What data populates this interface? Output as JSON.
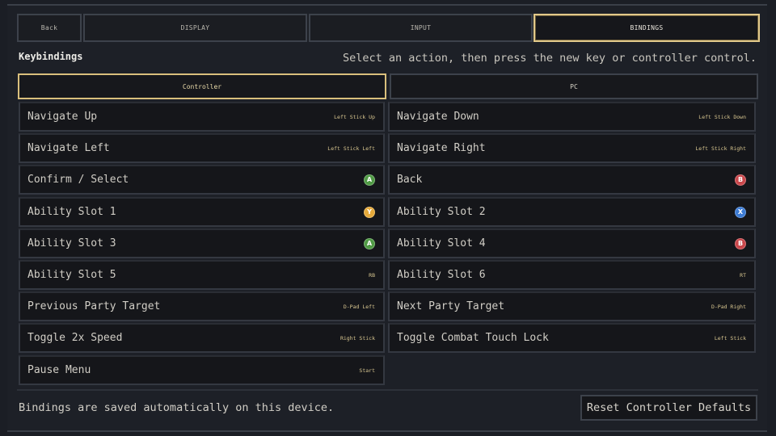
{
  "nav": {
    "back_label": "Back",
    "tabs": [
      {
        "label": "DISPLAY",
        "active": false
      },
      {
        "label": "INPUT",
        "active": false
      },
      {
        "label": "BINDINGS",
        "active": true
      }
    ]
  },
  "section": {
    "title": "Keybindings",
    "instruction": "Select an action, then press the new key or controller control."
  },
  "device_tabs": [
    {
      "label": "Controller",
      "active": true
    },
    {
      "label": "PC",
      "active": false
    }
  ],
  "bindings": [
    {
      "action": "Navigate Up",
      "binding": "Left Stick Up",
      "type": "text"
    },
    {
      "action": "Navigate Down",
      "binding": "Left Stick Down",
      "type": "text"
    },
    {
      "action": "Navigate Left",
      "binding": "Left Stick Left",
      "type": "text"
    },
    {
      "action": "Navigate Right",
      "binding": "Left Stick Right",
      "type": "text"
    },
    {
      "action": "Confirm / Select",
      "binding": "A",
      "type": "button",
      "color": "#4f9a44"
    },
    {
      "action": "Back",
      "binding": "B",
      "type": "button",
      "color": "#c9464a"
    },
    {
      "action": "Ability Slot 1",
      "binding": "Y",
      "type": "button",
      "color": "#e5a93a"
    },
    {
      "action": "Ability Slot 2",
      "binding": "X",
      "type": "button",
      "color": "#3c7bd4"
    },
    {
      "action": "Ability Slot 3",
      "binding": "A",
      "type": "button",
      "color": "#4f9a44"
    },
    {
      "action": "Ability Slot 4",
      "binding": "B",
      "type": "button",
      "color": "#c9464a"
    },
    {
      "action": "Ability Slot 5",
      "binding": "RB",
      "type": "text"
    },
    {
      "action": "Ability Slot 6",
      "binding": "RT",
      "type": "text"
    },
    {
      "action": "Previous Party Target",
      "binding": "D-Pad Left",
      "type": "text"
    },
    {
      "action": "Next Party Target",
      "binding": "D-Pad Right",
      "type": "text"
    },
    {
      "action": "Toggle 2x Speed",
      "binding": "Right Stick",
      "type": "text"
    },
    {
      "action": "Toggle Combat Touch Lock",
      "binding": "Left Stick",
      "type": "text"
    },
    {
      "action": "Pause Menu",
      "binding": "Start",
      "type": "text"
    }
  ],
  "footer": {
    "note": "Bindings are saved automatically on this device.",
    "reset_label": "Reset Controller Defaults"
  },
  "colors": {
    "accent": "#e2c98a",
    "background": "#1b1e25",
    "row_background": "#15161a"
  }
}
